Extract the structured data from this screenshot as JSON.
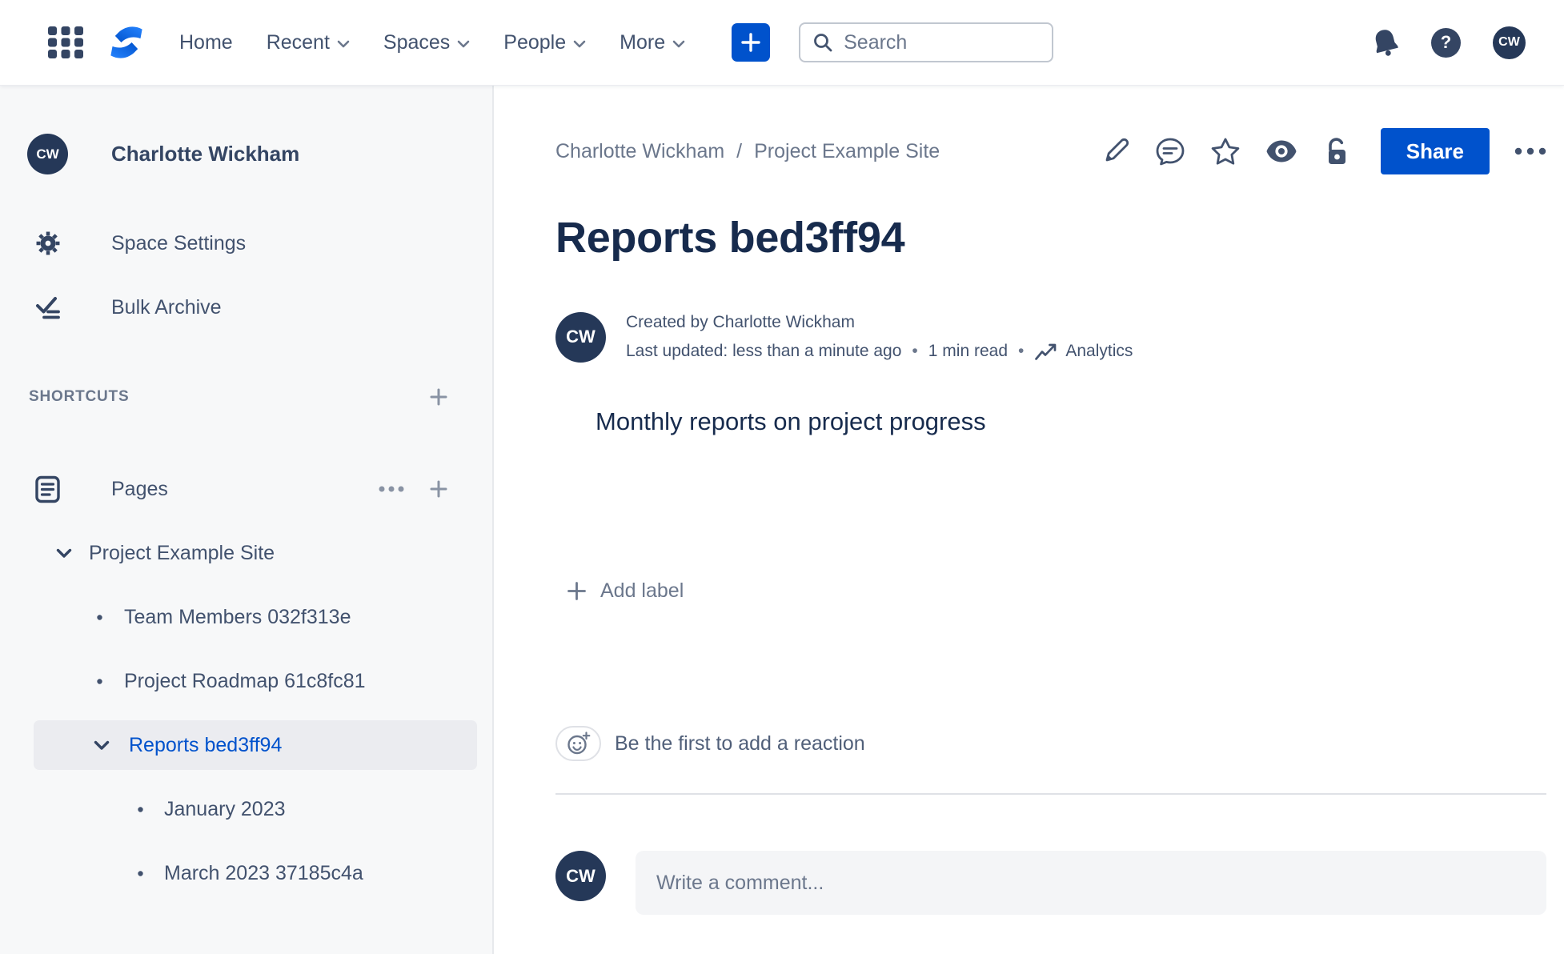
{
  "topbar": {
    "nav": [
      {
        "label": "Home",
        "has_dropdown": false
      },
      {
        "label": "Recent",
        "has_dropdown": true
      },
      {
        "label": "Spaces",
        "has_dropdown": true
      },
      {
        "label": "People",
        "has_dropdown": true
      },
      {
        "label": "More",
        "has_dropdown": true
      }
    ],
    "search_placeholder": "Search",
    "help_glyph": "?",
    "avatar_initials": "CW"
  },
  "sidebar": {
    "avatar_initials": "CW",
    "space_name": "Charlotte Wickham",
    "menu": [
      {
        "label": "Space Settings",
        "icon": "gear-icon"
      },
      {
        "label": "Bulk Archive",
        "icon": "bulk-archive-icon"
      }
    ],
    "shortcuts_label": "SHORTCUTS",
    "pages_label": "Pages",
    "tree": [
      {
        "label": "Project Example Site",
        "level": 0,
        "marker": "chevron-down",
        "selected": false
      },
      {
        "label": "Team Members 032f313e",
        "level": 1,
        "marker": "bullet",
        "selected": false
      },
      {
        "label": "Project Roadmap 61c8fc81",
        "level": 1,
        "marker": "bullet",
        "selected": false
      },
      {
        "label": "Reports bed3ff94",
        "level": 1,
        "marker": "chevron-down",
        "selected": true
      },
      {
        "label": "January 2023",
        "level": 2,
        "marker": "bullet",
        "selected": false
      },
      {
        "label": "March 2023 37185c4a",
        "level": 2,
        "marker": "bullet",
        "selected": false
      }
    ]
  },
  "content": {
    "breadcrumb": {
      "items": [
        "Charlotte Wickham",
        "Project Example Site"
      ],
      "separator": "/"
    },
    "share_label": "Share",
    "title": "Reports bed3ff94",
    "byline": {
      "avatar_initials": "CW",
      "created": "Created by Charlotte Wickham",
      "updated": "Last updated: less than a minute ago",
      "read_time": "1 min read",
      "analytics_label": "Analytics",
      "separator": "•"
    },
    "body_text": "Monthly reports on project progress",
    "add_label": "Add label",
    "reaction_text": "Be the first to add a reaction",
    "comment": {
      "avatar_initials": "CW",
      "placeholder": "Write a comment..."
    }
  },
  "colors": {
    "accent_blue": "#0052CC",
    "navy_text": "#172B4D",
    "icon_navy": "#344563",
    "muted_gray": "#6B778C",
    "sidebar_bg": "#F7F8F9",
    "selected_row_bg": "#EBECF0",
    "avatar_bg": "#253858"
  }
}
